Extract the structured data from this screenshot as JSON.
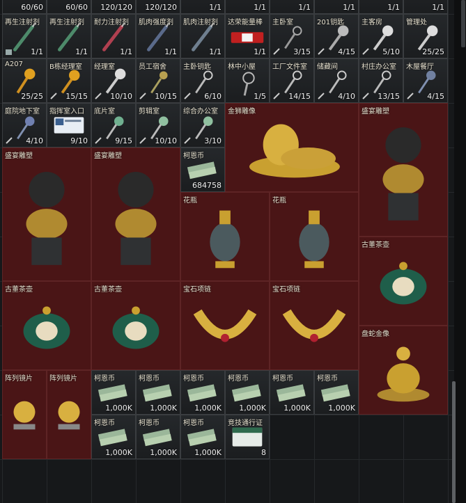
{
  "top_row": {
    "counts": [
      "60/60",
      "60/60",
      "120/120",
      "120/120",
      "1/1",
      "1/1",
      "1/1",
      "1/1",
      "1/1",
      "1/1"
    ]
  },
  "row1": [
    {
      "name": "再生注射剂",
      "count": "1/1"
    },
    {
      "name": "再生注射剂",
      "count": "1/1"
    },
    {
      "name": "耐力注射剂",
      "count": "1/1"
    },
    {
      "name": "肌肉强度剂",
      "count": "1/1"
    },
    {
      "name": "肌肉注射剂",
      "count": "1/1"
    },
    {
      "name": "达荣能量棒",
      "count": "1/1"
    },
    {
      "name": "主卧室",
      "count": "3/15"
    },
    {
      "name": "201钥匙",
      "count": "4/15"
    },
    {
      "name": "主客房",
      "count": "5/10"
    },
    {
      "name": "管理处",
      "count": "25/25"
    }
  ],
  "row2": [
    {
      "name": "A207",
      "count": "25/25"
    },
    {
      "name": "B栋经理室",
      "count": "15/15"
    },
    {
      "name": "经理室",
      "count": "10/10"
    },
    {
      "name": "员工宿舍",
      "count": "10/15"
    },
    {
      "name": "主卧钥匙",
      "count": "6/10"
    },
    {
      "name": "林中小屋",
      "count": "1/5"
    },
    {
      "name": "工厂文件室",
      "count": "14/15"
    },
    {
      "name": "储藏间",
      "count": "4/10"
    },
    {
      "name": "村庄办公室",
      "count": "13/15"
    },
    {
      "name": "木屋餐厅",
      "count": "4/15"
    }
  ],
  "row3": [
    {
      "name": "庭院地下室",
      "count": "4/10"
    },
    {
      "name": "指挥室入口",
      "count": "9/10"
    },
    {
      "name": "底片室",
      "count": "9/15"
    },
    {
      "name": "剪辑室",
      "count": "10/10"
    },
    {
      "name": "综合办公室",
      "count": "3/10"
    }
  ],
  "valuables": {
    "lion_statue": "金狮雕像",
    "sculpture": "盛宴雕塑",
    "coin": "柯恩币",
    "coin_big_count": "684758",
    "vase": "花瓶",
    "teapot": "古董茶壶",
    "necklace": "宝石项链",
    "snake": "盘蛇金像",
    "array_fragment": "阵列镜片",
    "pass": "竞技通行证",
    "pass_count": "8",
    "coin_count": "1,000K"
  },
  "colors": {
    "valuable_bg": "#4a1516",
    "normal_bg": "#1c1e20",
    "grid_line": "#26292c",
    "text": "#e8e2d0"
  },
  "icons": [
    "syringe-icon",
    "energy-bar-icon",
    "key-icon",
    "keycard-icon",
    "lion-statue-icon",
    "bust-statue-icon",
    "coin-stack-icon",
    "vase-icon",
    "teapot-icon",
    "necklace-icon",
    "snake-statue-icon",
    "lens-icon",
    "pass-card-icon",
    "lock-icon",
    "box-icon"
  ]
}
